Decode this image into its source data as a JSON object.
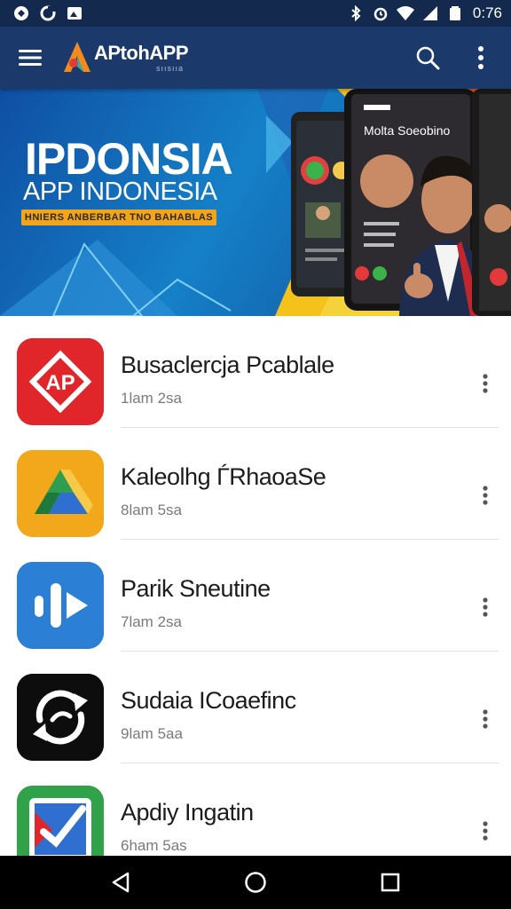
{
  "status_bar": {
    "time": "0:76",
    "icons": [
      "notification-icon",
      "sync-icon",
      "image-icon",
      "bluetooth-icon",
      "alarm-icon",
      "wifi-icon",
      "signal-icon",
      "battery-icon"
    ]
  },
  "app_bar": {
    "title": "APtohAPP",
    "subtitle": "sıısııa",
    "actions": [
      "search-icon",
      "more-vert-icon"
    ]
  },
  "banner": {
    "title": "IPDONSIA",
    "subtitle": "APP INDONESIA",
    "pill": "HNIERS ANBERBAR TNO BAHABLAS",
    "phone_header": "Molta Soeobino",
    "colors": {
      "blue": "#1580c8",
      "yellow": "#f4c21a",
      "orange": "#e5571f"
    }
  },
  "apps": [
    {
      "name": "Busaclercja Pcablale",
      "meta": "1lam 2sa",
      "icon": "ap-logo-icon",
      "color": "#e0262b"
    },
    {
      "name": "Kaleolhg ЃRhaoaSe",
      "meta": "8lam 5sa",
      "icon": "drive-triangle-icon",
      "color": "#f3a71a"
    },
    {
      "name": "Parik Sneutine",
      "meta": "7lam 2sa",
      "icon": "play-pause-icon",
      "color": "#2b7fd4"
    },
    {
      "name": "Sudaia ICoaefinc",
      "meta": "9lam 5aa",
      "icon": "refresh-swirl-icon",
      "color": "#0d0d0d"
    },
    {
      "name": "Apdiy Ingatin",
      "meta": "6ham 5as",
      "icon": "checkmark-icon",
      "color": "#2fa24a"
    }
  ],
  "nav": [
    "back-icon",
    "home-icon",
    "recents-icon"
  ]
}
